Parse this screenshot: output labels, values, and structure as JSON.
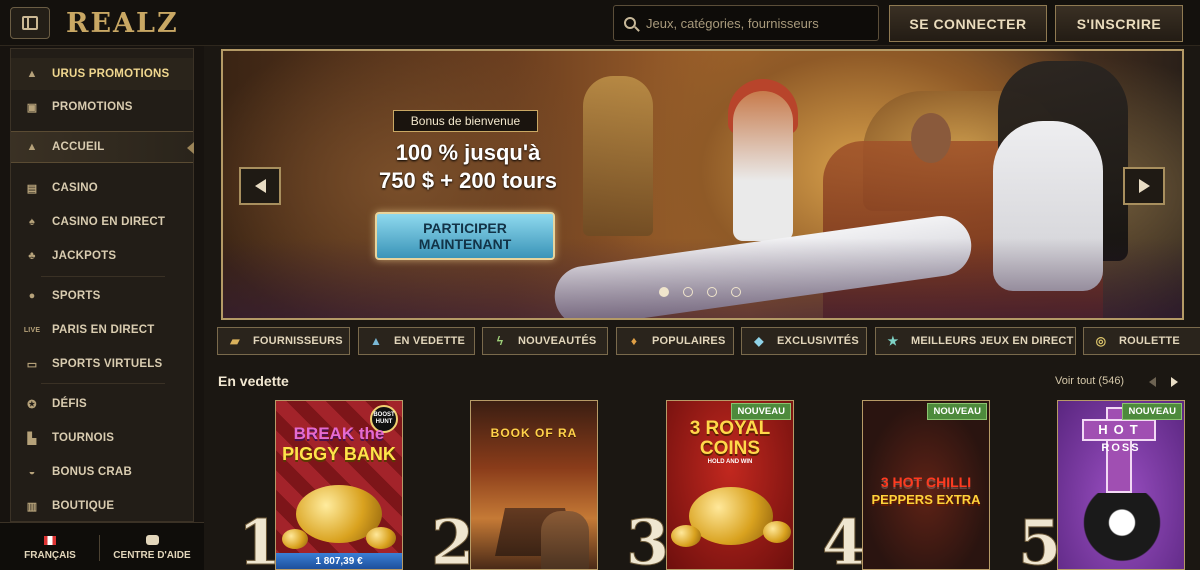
{
  "header": {
    "logo": "REALZ",
    "search_placeholder": "Jeux, catégories, fournisseurs",
    "login_label": "SE CONNECTER",
    "register_label": "S'INSCRIRE"
  },
  "sidebar": {
    "items": [
      {
        "label": "URUS PROMOTIONS",
        "icon": "car-icon"
      },
      {
        "label": "PROMOTIONS",
        "icon": "gift-icon"
      },
      {
        "label": "ACCUEIL",
        "icon": "pyramid-icon"
      },
      {
        "label": "CASINO",
        "icon": "slot-machine-icon"
      },
      {
        "label": "CASINO EN DIRECT",
        "icon": "cards-icon"
      },
      {
        "label": "JACKPOTS",
        "icon": "clover-icon"
      },
      {
        "label": "SPORTS",
        "icon": "ball-icon"
      },
      {
        "label": "PARIS EN DIRECT",
        "icon": "live-icon"
      },
      {
        "label": "SPORTS VIRTUELS",
        "icon": "monitor-icon"
      },
      {
        "label": "DÉFIS",
        "icon": "medal-icon"
      },
      {
        "label": "TOURNOIS",
        "icon": "podium-icon"
      },
      {
        "label": "BONUS CRAB",
        "icon": "claw-icon"
      },
      {
        "label": "BOUTIQUE",
        "icon": "shop-icon"
      }
    ],
    "footer": {
      "language_label": "FRANÇAIS",
      "help_label": "CENTRE D'AIDE"
    }
  },
  "hero": {
    "badge": "Bonus de bienvenue",
    "title_line1": "100 % jusqu'à",
    "title_line2": "750 $ + 200 tours",
    "cta_line1": "PARTICIPER",
    "cta_line2": "MAINTENANT",
    "slide_count": 4,
    "active_slide": 1
  },
  "tabs": [
    {
      "label": "FOURNISSEURS",
      "icon": "scroll-icon"
    },
    {
      "label": "EN VEDETTE",
      "icon": "pyramid-icon"
    },
    {
      "label": "NOUVEAUTÉS",
      "icon": "lightning-icon"
    },
    {
      "label": "POPULAIRES",
      "icon": "flame-icon"
    },
    {
      "label": "EXCLUSIVITÉS",
      "icon": "diamond-icon"
    },
    {
      "label": "MEILLEURS JEUX EN DIRECT",
      "icon": "star-icon"
    },
    {
      "label": "ROULETTE",
      "icon": "roulette-icon"
    }
  ],
  "featured": {
    "title": "En vedette",
    "see_all": "Voir tout (546)",
    "games": [
      {
        "rank": "1",
        "name_line1": "BREAK the",
        "name_line2": "PIGGY BANK",
        "corner": "BOOST HUNT",
        "jackpot": "1 807,39 €",
        "is_new": false
      },
      {
        "rank": "2",
        "name_line1": "BOOK OF RA",
        "name_line2": "",
        "is_new": false
      },
      {
        "rank": "3",
        "name_line1": "3 ROYAL",
        "name_line2": "COINS",
        "sub": "HOLD AND WIN",
        "is_new": true
      },
      {
        "rank": "4",
        "name_line1": "3 HOT CHILLI",
        "name_line2": "PEPPERS EXTRA",
        "is_new": true
      },
      {
        "rank": "5",
        "name_line1": "HOT",
        "name_line2": "ROSS",
        "is_new": true
      }
    ],
    "new_label": "NOUVEAU"
  }
}
